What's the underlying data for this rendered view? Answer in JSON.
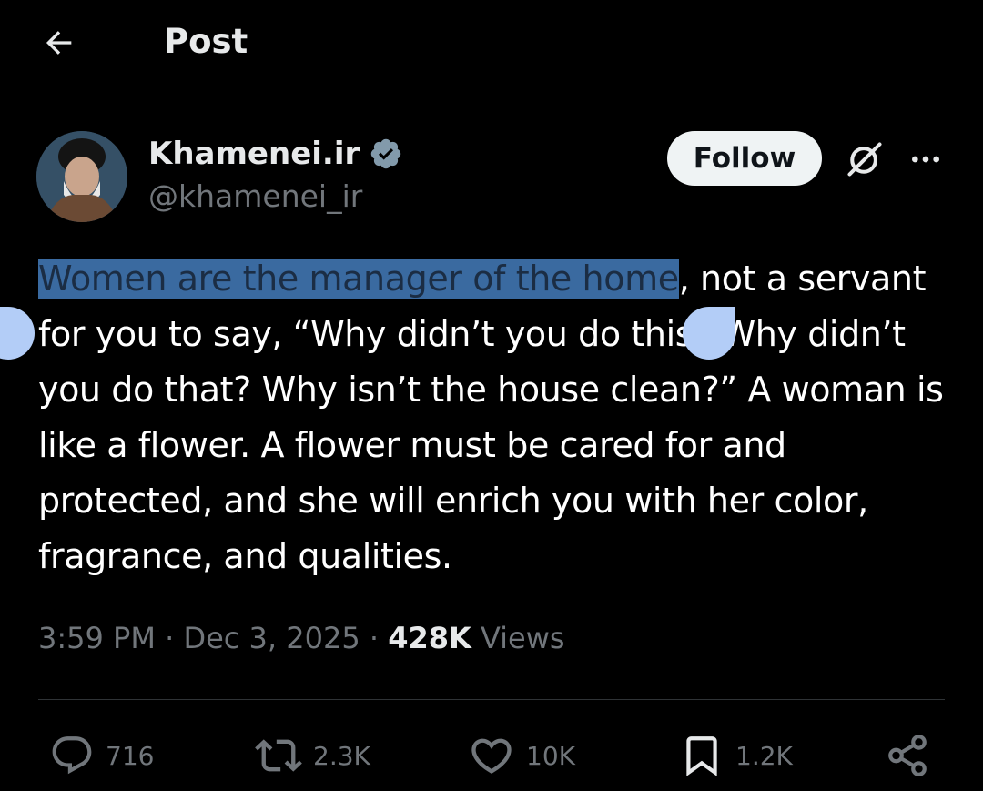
{
  "header": {
    "title": "Post"
  },
  "author": {
    "display_name": "Khamenei.ir",
    "handle": "@khamenei_ir",
    "follow_label": "Follow"
  },
  "post": {
    "highlighted_text": "Women are the manager of the home",
    "rest_text": ", not a servant for you to say, “Why didn’t you do this? Why didn’t you do that? Why isn’t the house clean?” A woman is like a flower. A flower must be cared for and protected, and she will enrich you with her color, fragrance, and qualities."
  },
  "meta": {
    "time": "3:59 PM",
    "separator": "·",
    "date": "Dec 3, 2025",
    "views_count": "428K",
    "views_label": "Views"
  },
  "actions": {
    "replies": "716",
    "reposts": "2.3K",
    "likes": "10K",
    "bookmarks": "1.2K"
  },
  "icons": {
    "back": "arrow-left-icon",
    "verified": "verified-badge-icon",
    "grok": "grok-icon",
    "more": "more-dots-icon",
    "reply": "reply-bubble-icon",
    "repost": "repost-icon",
    "like": "heart-icon",
    "bookmark": "bookmark-icon",
    "share": "share-icon"
  },
  "colors": {
    "background": "#000000",
    "text_primary": "#e7e9ea",
    "text_secondary": "#71767b",
    "selection_highlight": "#3a6aa0",
    "selection_handle": "#b3cdf7",
    "follow_button": "#eff3f4"
  }
}
